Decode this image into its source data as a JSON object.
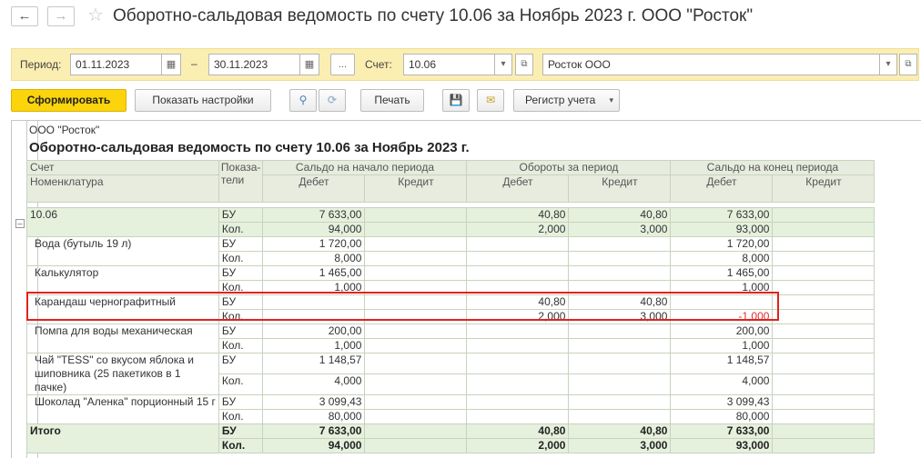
{
  "window": {
    "title": "Оборотно-сальдовая ведомость по счету 10.06 за Ноябрь 2023 г. ООО \"Росток\"",
    "back_icon": "arrow-left",
    "forward_icon": "arrow-right",
    "favorite_icon": "star"
  },
  "params": {
    "period_label": "Период:",
    "date_from": "01.11.2023",
    "dash": "–",
    "date_to": "30.11.2023",
    "more_btn": "...",
    "account_label": "Счет:",
    "account_value": "10.06",
    "org_value": "Росток ООО"
  },
  "toolbar": {
    "generate": "Сформировать",
    "show_settings": "Показать настройки",
    "print": "Печать",
    "register": "Регистр учета"
  },
  "report": {
    "org": "ООО \"Росток\"",
    "title": "Оборотно-сальдовая ведомость по счету 10.06 за Ноябрь 2023 г.",
    "headers": {
      "account": "Счет",
      "nomenclature": "Номенклатура",
      "indicators": "Показа-тели",
      "opening": "Сальдо на начало периода",
      "turnover": "Обороты за период",
      "closing": "Сальдо на конец периода",
      "debit": "Дебет",
      "credit": "Кредит"
    },
    "groups": [
      {
        "name": "10.06",
        "type": "account",
        "rows": [
          {
            "ind": "БУ",
            "values": [
              "7 633,00",
              "",
              "40,80",
              "40,80",
              "7 633,00",
              ""
            ]
          },
          {
            "ind": "Кол.",
            "values": [
              "94,000",
              "",
              "2,000",
              "3,000",
              "93,000",
              ""
            ]
          }
        ]
      },
      {
        "name": "Вода (бутыль 19 л)",
        "type": "item",
        "rows": [
          {
            "ind": "БУ",
            "values": [
              "1 720,00",
              "",
              "",
              "",
              "1 720,00",
              ""
            ]
          },
          {
            "ind": "Кол.",
            "values": [
              "8,000",
              "",
              "",
              "",
              "8,000",
              ""
            ]
          }
        ]
      },
      {
        "name": "Калькулятор",
        "type": "item",
        "rows": [
          {
            "ind": "БУ",
            "values": [
              "1 465,00",
              "",
              "",
              "",
              "1 465,00",
              ""
            ]
          },
          {
            "ind": "Кол.",
            "values": [
              "1,000",
              "",
              "",
              "",
              "1,000",
              ""
            ]
          }
        ]
      },
      {
        "name": "Карандаш чернографитный",
        "type": "item",
        "highlight": true,
        "rows": [
          {
            "ind": "БУ",
            "values": [
              "",
              "",
              "40,80",
              "40,80",
              "",
              ""
            ]
          },
          {
            "ind": "Кол.",
            "values": [
              "",
              "",
              "2,000",
              "3,000",
              "-1,000",
              ""
            ]
          }
        ]
      },
      {
        "name": "Помпа для воды механическая",
        "type": "item",
        "rows": [
          {
            "ind": "БУ",
            "values": [
              "200,00",
              "",
              "",
              "",
              "200,00",
              ""
            ]
          },
          {
            "ind": "Кол.",
            "values": [
              "1,000",
              "",
              "",
              "",
              "1,000",
              ""
            ]
          }
        ]
      },
      {
        "name": "Чай \"TESS\" со вкусом яблока и шиповника (25 пакетиков в 1 пачке)",
        "type": "item",
        "rows": [
          {
            "ind": "БУ",
            "values": [
              "1 148,57",
              "",
              "",
              "",
              "1 148,57",
              ""
            ]
          },
          {
            "ind": "Кол.",
            "values": [
              "4,000",
              "",
              "",
              "",
              "4,000",
              ""
            ]
          }
        ]
      },
      {
        "name": "Шоколад \"Аленка\" порционный 15 г",
        "type": "item",
        "rows": [
          {
            "ind": "БУ",
            "values": [
              "3 099,43",
              "",
              "",
              "",
              "3 099,43",
              ""
            ]
          },
          {
            "ind": "Кол.",
            "values": [
              "80,000",
              "",
              "",
              "",
              "80,000",
              ""
            ]
          }
        ]
      }
    ],
    "total": {
      "name": "Итого",
      "rows": [
        {
          "ind": "БУ",
          "values": [
            "7 633,00",
            "",
            "40,80",
            "40,80",
            "7 633,00",
            ""
          ]
        },
        {
          "ind": "Кол.",
          "values": [
            "94,000",
            "",
            "2,000",
            "3,000",
            "93,000",
            ""
          ]
        }
      ]
    }
  },
  "colors": {
    "params_bg": "#fbeeb1",
    "primary_btn": "#fbd40c",
    "header_bg": "#e7ecdf",
    "account_row_bg": "#e5f0dd",
    "highlight_border": "#e0231d",
    "negative_text": "#e03030"
  }
}
